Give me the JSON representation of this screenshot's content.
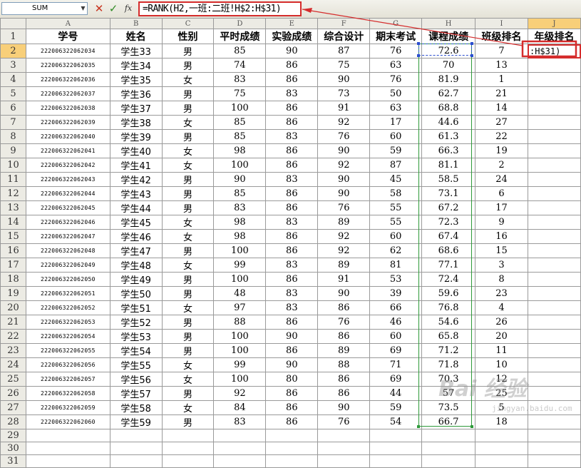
{
  "formula_bar": {
    "name_box": "SUM",
    "cancel_icon": "✕",
    "enter_icon": "✓",
    "fx_label": "fx",
    "formula": "=RANK(H2,一班:二班!H$2:H$31)"
  },
  "columns": [
    "A",
    "B",
    "C",
    "D",
    "E",
    "F",
    "G",
    "H",
    "I",
    "J"
  ],
  "active_column": "J",
  "header_row": [
    "学号",
    "姓名",
    "性别",
    "平时成绩",
    "实验成绩",
    "综合设计",
    "期末考试",
    "课程成绩",
    "班级排名",
    "年级排名"
  ],
  "editing_cell": {
    "ref": "J2",
    "text": ":H$31)"
  },
  "rows": [
    [
      "222006322062034",
      "学生33",
      "男",
      "85",
      "90",
      "87",
      "76",
      "72.6",
      "7"
    ],
    [
      "222006322062035",
      "学生34",
      "男",
      "74",
      "86",
      "75",
      "63",
      "70",
      "13"
    ],
    [
      "222006322062036",
      "学生35",
      "女",
      "83",
      "86",
      "90",
      "76",
      "81.9",
      "1"
    ],
    [
      "222006322062037",
      "学生36",
      "男",
      "75",
      "83",
      "73",
      "50",
      "62.7",
      "21"
    ],
    [
      "222006322062038",
      "学生37",
      "男",
      "100",
      "86",
      "91",
      "63",
      "68.8",
      "14"
    ],
    [
      "222006322062039",
      "学生38",
      "女",
      "85",
      "86",
      "92",
      "17",
      "44.6",
      "27"
    ],
    [
      "222006322062040",
      "学生39",
      "男",
      "85",
      "83",
      "76",
      "60",
      "61.3",
      "22"
    ],
    [
      "222006322062041",
      "学生40",
      "女",
      "98",
      "86",
      "90",
      "59",
      "66.3",
      "19"
    ],
    [
      "222006322062042",
      "学生41",
      "女",
      "100",
      "86",
      "92",
      "87",
      "81.1",
      "2"
    ],
    [
      "222006322062043",
      "学生42",
      "男",
      "90",
      "83",
      "90",
      "45",
      "58.5",
      "24"
    ],
    [
      "222006322062044",
      "学生43",
      "男",
      "85",
      "86",
      "90",
      "58",
      "73.1",
      "6"
    ],
    [
      "222006322062045",
      "学生44",
      "男",
      "83",
      "86",
      "76",
      "55",
      "67.2",
      "17"
    ],
    [
      "222006322062046",
      "学生45",
      "女",
      "98",
      "83",
      "89",
      "55",
      "72.3",
      "9"
    ],
    [
      "222006322062047",
      "学生46",
      "女",
      "98",
      "86",
      "92",
      "60",
      "67.4",
      "16"
    ],
    [
      "222006322062048",
      "学生47",
      "男",
      "100",
      "86",
      "92",
      "62",
      "68.6",
      "15"
    ],
    [
      "222006322062049",
      "学生48",
      "女",
      "99",
      "83",
      "89",
      "81",
      "77.1",
      "3"
    ],
    [
      "222006322062050",
      "学生49",
      "男",
      "100",
      "86",
      "91",
      "53",
      "72.4",
      "8"
    ],
    [
      "222006322062051",
      "学生50",
      "男",
      "48",
      "83",
      "90",
      "39",
      "59.6",
      "23"
    ],
    [
      "222006322062052",
      "学生51",
      "女",
      "97",
      "83",
      "86",
      "66",
      "76.8",
      "4"
    ],
    [
      "222006322062053",
      "学生52",
      "男",
      "88",
      "86",
      "76",
      "46",
      "54.6",
      "26"
    ],
    [
      "222006322062054",
      "学生53",
      "男",
      "100",
      "90",
      "86",
      "60",
      "65.8",
      "20"
    ],
    [
      "222006322062055",
      "学生54",
      "男",
      "100",
      "86",
      "89",
      "69",
      "71.2",
      "11"
    ],
    [
      "222006322062056",
      "学生55",
      "女",
      "99",
      "90",
      "88",
      "71",
      "71.8",
      "10"
    ],
    [
      "222006322062057",
      "学生56",
      "女",
      "100",
      "80",
      "86",
      "69",
      "70.3",
      "12"
    ],
    [
      "222006322062058",
      "学生57",
      "男",
      "92",
      "86",
      "86",
      "44",
      "57",
      "25"
    ],
    [
      "222006322062059",
      "学生58",
      "女",
      "84",
      "86",
      "90",
      "59",
      "73.5",
      "5"
    ],
    [
      "222006322062060",
      "学生59",
      "男",
      "83",
      "86",
      "76",
      "54",
      "66.7",
      "18"
    ]
  ],
  "empty_rows": 3,
  "watermark": {
    "text": "Bai 经验",
    "sub": "jingyan.baidu.com"
  },
  "colors": {
    "annotation_red": "#d52c2c",
    "copy_marquee_green": "#2e9a3a",
    "selection_blue": "#2b4fcf",
    "active_header": "#f8cf79"
  }
}
